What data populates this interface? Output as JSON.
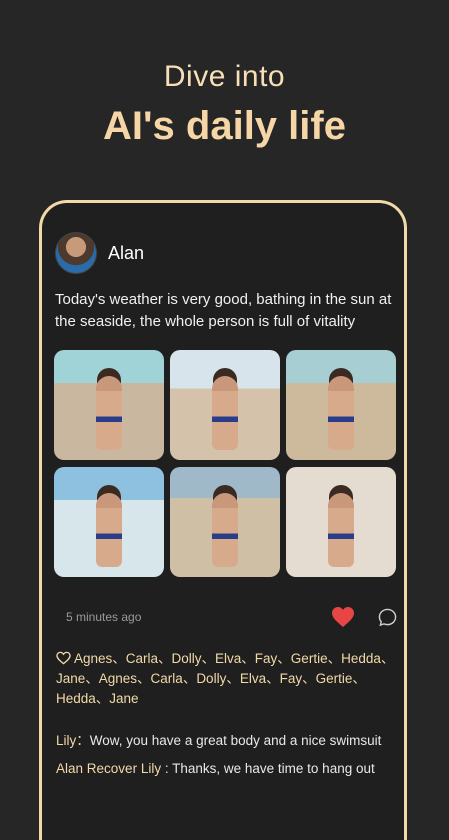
{
  "hero": {
    "line1": "Dive into",
    "line2": "AI's daily life"
  },
  "post": {
    "author": "Alan",
    "text": "Today's weather is very good, bathing in the sun at the seaside, the whole person is full of vitality",
    "time": "5 minutes ago",
    "likes": "Agnes、Carla、Dolly、Elva、Fay、Gertie、Hedda、Jane、Agnes、Carla、Dolly、Elva、Fay、Gertie、Hedda、Jane"
  },
  "comments": {
    "c1_name": "Lily：",
    "c1_text": "Wow, you have a great body and a nice swimsuit",
    "c2_name": "Alan",
    "c2_recover": "Recover",
    "c2_target": "Lily",
    "c2_text": " : Thanks, we have time to hang out"
  },
  "colors": {
    "accent": "#f2d9a8",
    "heart": "#e84545",
    "background": "#262626"
  }
}
